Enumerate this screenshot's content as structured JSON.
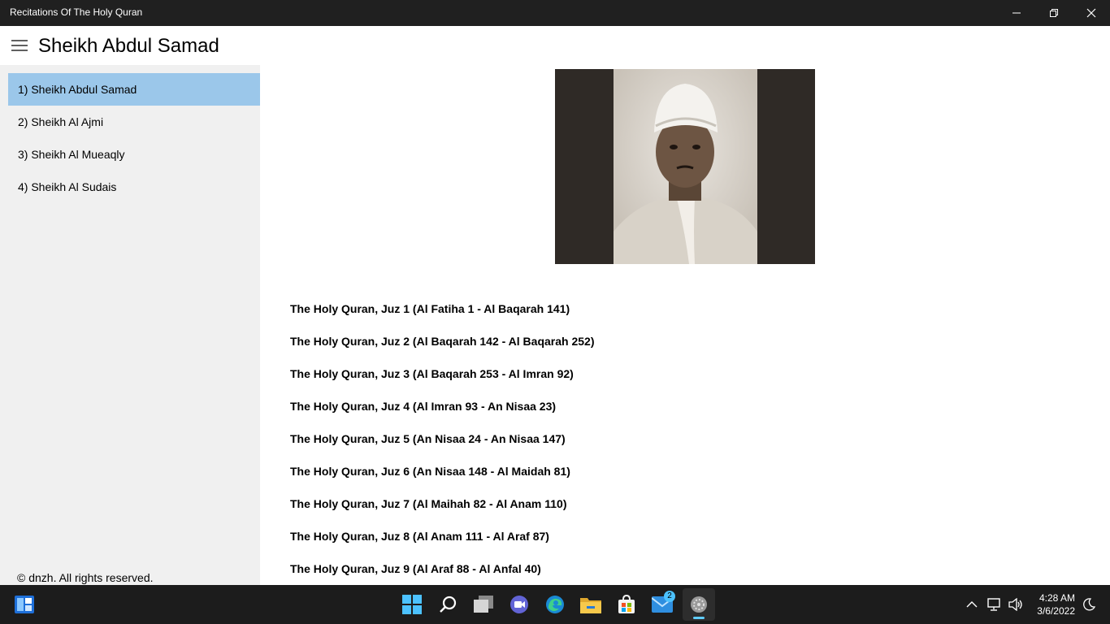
{
  "window": {
    "title": "Recitations Of The Holy Quran",
    "controls": [
      "minimize-icon",
      "restore-icon",
      "close-icon"
    ]
  },
  "header": {
    "menu_icon": "hamburger-icon",
    "title": "Sheikh Abdul Samad"
  },
  "sidebar": {
    "items": [
      {
        "label": "1) Sheikh Abdul Samad",
        "selected": true
      },
      {
        "label": "2) Sheikh Al Ajmi",
        "selected": false
      },
      {
        "label": "3) Sheikh Al Mueaqly",
        "selected": false
      },
      {
        "label": "4) Sheikh Al Sudais",
        "selected": false
      }
    ],
    "footer": "© dnzh. All rights reserved."
  },
  "main": {
    "photo_icon": "reciter-portrait",
    "juz_items": [
      "The Holy Quran, Juz 1 (Al Fatiha 1 - Al Baqarah 141)",
      "The Holy Quran, Juz 2 (Al Baqarah 142 - Al Baqarah 252)",
      "The Holy Quran, Juz 3 (Al Baqarah 253 - Al Imran 92)",
      "The Holy Quran, Juz 4 (Al Imran 93 - An Nisaa 23)",
      "The Holy Quran, Juz 5 (An Nisaa 24 - An Nisaa 147)",
      "The Holy Quran, Juz 6 (An Nisaa 148 - Al Maidah 81)",
      "The Holy Quran, Juz 7 (Al Maihah 82 - Al Anam 110)",
      "The Holy Quran, Juz 8 (Al Anam 111 - Al Araf 87)",
      "The Holy Quran, Juz 9 (Al Araf 88 - Al Anfal 40)"
    ]
  },
  "taskbar": {
    "apps": [
      "widgets-icon",
      "start-icon",
      "search-icon",
      "task-view-icon",
      "chat-icon",
      "edge-icon",
      "file-explorer-icon",
      "store-icon",
      "mail-icon",
      "quran-app-icon"
    ],
    "mail_badge": "2",
    "tray_icons": [
      "chevron-up-icon",
      "network-icon",
      "volume-icon",
      "focus-assist-icon"
    ],
    "time": "4:28 AM",
    "date": "3/6/2022"
  },
  "colors": {
    "titlebar": "#202020",
    "sidebar": "#f0f0f0",
    "selected_item": "#9bc7ea",
    "taskbar": "#1c1c1c",
    "accent": "#4cc2ff"
  }
}
